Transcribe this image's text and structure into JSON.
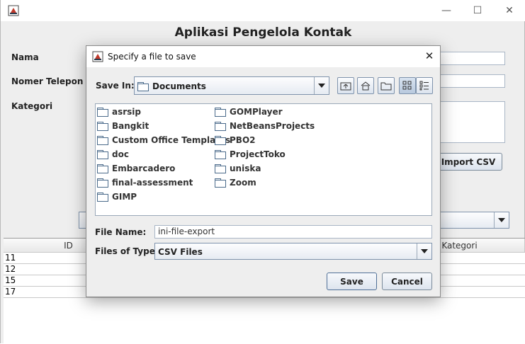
{
  "main_window": {
    "title": "",
    "heading": "Aplikasi Pengelola Kontak",
    "labels": {
      "nama": "Nama",
      "nomer_telepon": "Nomer Telepon",
      "kategori": "Kategori"
    },
    "import_button": "Import CSV",
    "window_controls": {
      "minimize": "—",
      "maximize": "☐",
      "close": "✕"
    },
    "table": {
      "columns": [
        "ID",
        "Kategori"
      ],
      "rows": [
        [
          "11"
        ],
        [
          "12"
        ],
        [
          "15"
        ],
        [
          "17"
        ]
      ]
    }
  },
  "dialog": {
    "title": "Specify a file to save",
    "close": "✕",
    "save_in_label": "Save In:",
    "save_in_value": "Documents",
    "files": [
      "asrsip",
      "Bangkit",
      "Custom Office Templates",
      "doc",
      "Embarcadero",
      "final-assessment",
      "GIMP",
      "GOMPlayer",
      "NetBeansProjects",
      "PBO2",
      "ProjectToko",
      "uniska",
      "Zoom"
    ],
    "file_name_label": "File Name:",
    "file_name_value": "ini-file-export",
    "file_type_label": "Files of Type:",
    "file_type_value": "CSV Files",
    "save_button": "Save",
    "cancel_button": "Cancel"
  }
}
